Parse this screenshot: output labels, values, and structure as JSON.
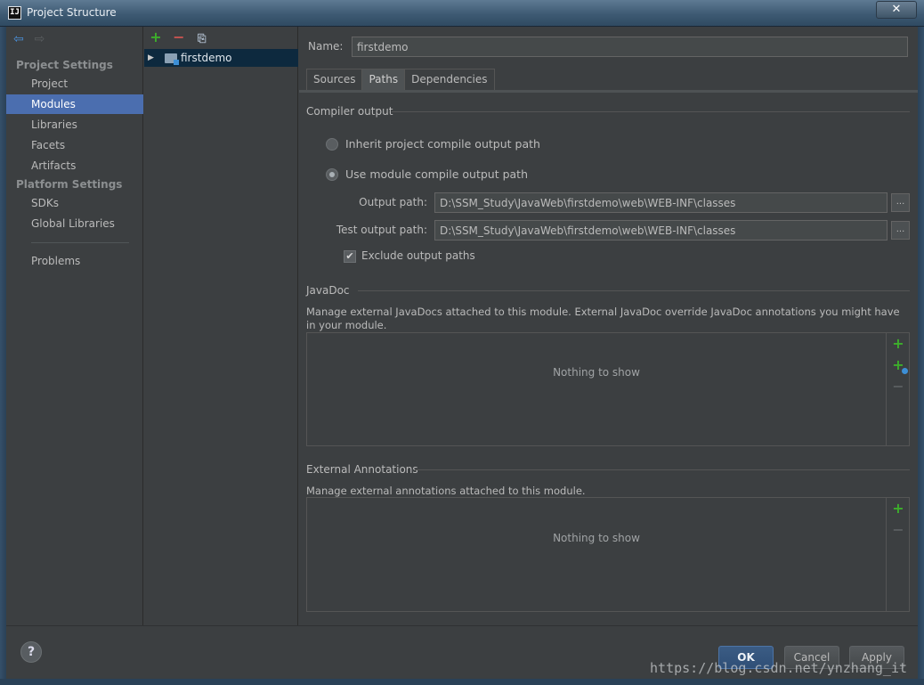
{
  "window": {
    "title": "Project Structure",
    "app_icon_text": "IJ",
    "close_glyph": "✕"
  },
  "nav": {
    "back_glyph": "⇦",
    "forward_glyph": "⇨"
  },
  "categories": {
    "project_settings_label": "Project Settings",
    "platform_settings_label": "Platform Settings",
    "items": [
      {
        "label": "Project"
      },
      {
        "label": "Modules",
        "selected": true
      },
      {
        "label": "Libraries"
      },
      {
        "label": "Facets"
      },
      {
        "label": "Artifacts"
      },
      {
        "label": "SDKs"
      },
      {
        "label": "Global Libraries"
      },
      {
        "label": "Problems"
      }
    ]
  },
  "tree": {
    "toolbar": {
      "add": "+",
      "remove": "−",
      "copy": "⎘"
    },
    "modules": [
      {
        "label": "firstdemo",
        "expander": "▶"
      }
    ]
  },
  "detail": {
    "name_label": "Name:",
    "name_value": "firstdemo",
    "tabs": [
      {
        "label": "Sources"
      },
      {
        "label": "Paths",
        "active": true
      },
      {
        "label": "Dependencies"
      }
    ],
    "compiler_output": {
      "title": "Compiler output",
      "inherit_label": "Inherit project compile output path",
      "use_module_label": "Use module compile output path",
      "selected_option": "use_module",
      "output_path_label": "Output path:",
      "output_path_value": "D:\\SSM_Study\\JavaWeb\\firstdemo\\web\\WEB-INF\\classes",
      "test_output_path_label": "Test output path:",
      "test_output_path_value": "D:\\SSM_Study\\JavaWeb\\firstdemo\\web\\WEB-INF\\classes",
      "browse_label": "...",
      "exclude_label": "Exclude output paths",
      "exclude_checked": true,
      "check_glyph": "✔"
    },
    "javadoc": {
      "title": "JavaDoc",
      "description": "Manage external JavaDocs attached to this module. External JavaDoc override JavaDoc annotations you might have in your module.",
      "empty_text": "Nothing to show"
    },
    "external_annotations": {
      "title": "External Annotations",
      "description": "Manage external annotations attached to this module.",
      "empty_text": "Nothing to show"
    },
    "list_toolbar": {
      "add": "+",
      "minus": "−"
    }
  },
  "buttons": {
    "help": "?",
    "ok": "OK",
    "cancel": "Cancel",
    "apply": "Apply"
  },
  "watermark": "https://blog.csdn.net/ynzhang_it",
  "colors": {
    "background": "#3c3f41",
    "selection": "#4b6eaf",
    "tree_selection": "#0d293e",
    "add_green": "#3dae2b",
    "remove_red": "#c75450",
    "primary_button": "#2f4f77"
  }
}
